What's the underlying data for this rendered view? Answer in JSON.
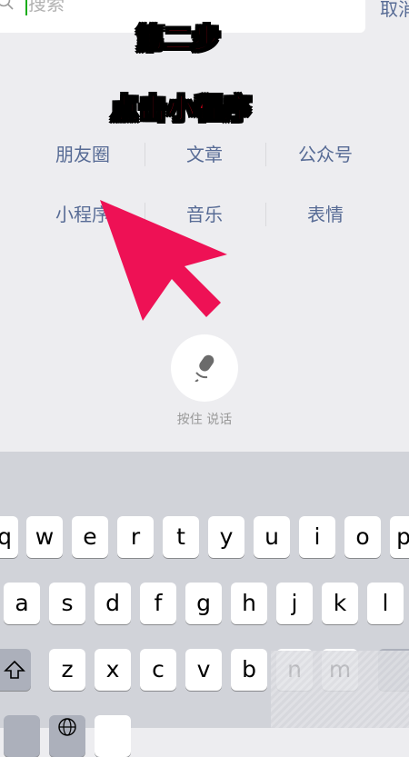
{
  "search": {
    "placeholder": "搜索",
    "cancel_label": "取消"
  },
  "overlay": {
    "step_text": "第二步",
    "instruction_text": "点击小程序"
  },
  "categories": [
    {
      "label": "朋友圈"
    },
    {
      "label": "文章"
    },
    {
      "label": "公众号"
    },
    {
      "label": "小程序"
    },
    {
      "label": "音乐"
    },
    {
      "label": "表情"
    }
  ],
  "voice": {
    "icon": "microphone-icon",
    "label": "按住 说话"
  },
  "keyboard": {
    "row1": [
      "q",
      "w",
      "e",
      "r",
      "t",
      "y",
      "u",
      "i",
      "o",
      "p"
    ],
    "row2": [
      "a",
      "s",
      "d",
      "f",
      "g",
      "h",
      "j",
      "k",
      "l"
    ],
    "row3": [
      "z",
      "x",
      "c",
      "v",
      "b",
      "n",
      "m"
    ]
  },
  "colors": {
    "link": "#576b95",
    "annotation_red": "#e8001a",
    "arrow_pink": "#ee1155"
  }
}
